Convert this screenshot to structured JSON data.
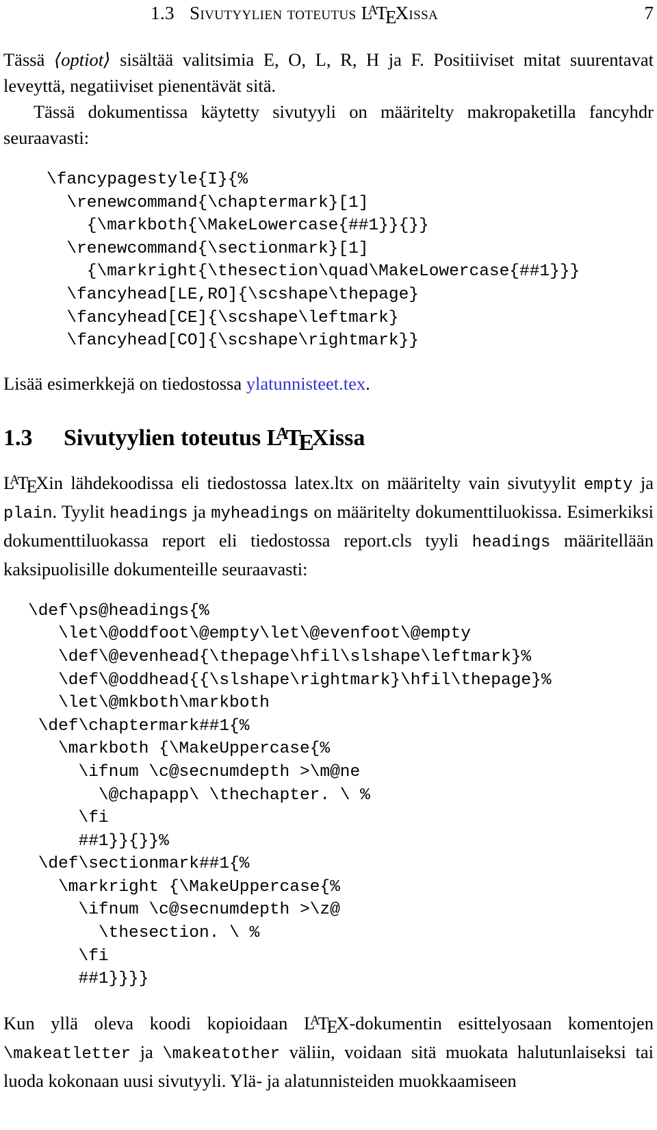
{
  "header": {
    "section_number": "1.3",
    "title_before_logo": "Sivutyylien toteutus ",
    "logo": "LaTeX",
    "title_after_logo": "issa",
    "page_number": "7"
  },
  "paragraphs": {
    "p1_a": "Tässä ",
    "p1_optiot": "⟨optiot⟩",
    "p1_b": " sisältää valitsimia E, O, L, R, H ja F. Positiiviset mitat suurentavat leveyttä, negatiiviset pienentävät sitä.",
    "p2": "Tässä dokumentissa käytetty sivutyyli on määritelty makropaketilla fancyhdr seuraavasti:",
    "p3_a": "Lisää esimerkkejä on tiedostossa ",
    "p3_link": "ylatunnisteet.tex",
    "p3_b": ".",
    "p4_a": "in lähdekoodissa eli tiedostossa latex.ltx on määritelty vain sivutyylit ",
    "p4_tt1": "empty",
    "p4_b": " ja ",
    "p4_tt2": "plain",
    "p4_c": ". Tyylit ",
    "p4_tt3": "headings",
    "p4_d": " ja ",
    "p4_tt4": "myheadings",
    "p4_e": " on määritelty dokumenttiluokissa. Esimerkiksi dokumenttiluokassa report eli tiedostossa report.cls tyyli ",
    "p4_tt5": "headings",
    "p4_f": " määritellään kaksipuolisille dokumenteille seuraavasti:",
    "p5_a": "Kun yllä oleva koodi kopioidaan ",
    "p5_b": "-dokumentin esittelyosaan komentojen ",
    "p5_tt1": "\\makeatletter",
    "p5_c": " ja ",
    "p5_tt2": "\\makeatother",
    "p5_d": " väliin, voidaan sitä muokata halutunlaiseksi tai luoda kokonaan uusi sivutyyli. Ylä- ja alatunnisteiden muokkaamiseen"
  },
  "code_block_1": "\\fancypagestyle{I}{%\n  \\renewcommand{\\chaptermark}[1]\n    {\\markboth{\\MakeLowercase{##1}}{}}\n  \\renewcommand{\\sectionmark}[1]\n    {\\markright{\\thesection\\quad\\MakeLowercase{##1}}}\n  \\fancyhead[LE,RO]{\\scshape\\thepage}\n  \\fancyhead[CE]{\\scshape\\leftmark}\n  \\fancyhead[CO]{\\scshape\\rightmark}}",
  "section": {
    "number": "1.3",
    "title_before_logo": "Sivutyylien toteutus ",
    "logo": "LaTeX",
    "title_after_logo": "issa"
  },
  "code_block_2": "\\def\\ps@headings{%\n   \\let\\@oddfoot\\@empty\\let\\@evenfoot\\@empty\n   \\def\\@evenhead{\\thepage\\hfil\\slshape\\leftmark}%\n   \\def\\@oddhead{{\\slshape\\rightmark}\\hfil\\thepage}%\n   \\let\\@mkboth\\markboth\n \\def\\chaptermark##1{%\n   \\markboth {\\MakeUppercase{%\n     \\ifnum \\c@secnumdepth >\\m@ne\n       \\@chapapp\\ \\thechapter. \\ %\n     \\fi\n     ##1}}{}}%\n \\def\\sectionmark##1{%\n   \\markright {\\MakeUppercase{%\n     \\ifnum \\c@secnumdepth >\\z@\n       \\thesection. \\ %\n     \\fi\n     ##1}}}}",
  "colors": {
    "link": "#3333cc",
    "text": "#000000",
    "background": "#ffffff"
  }
}
